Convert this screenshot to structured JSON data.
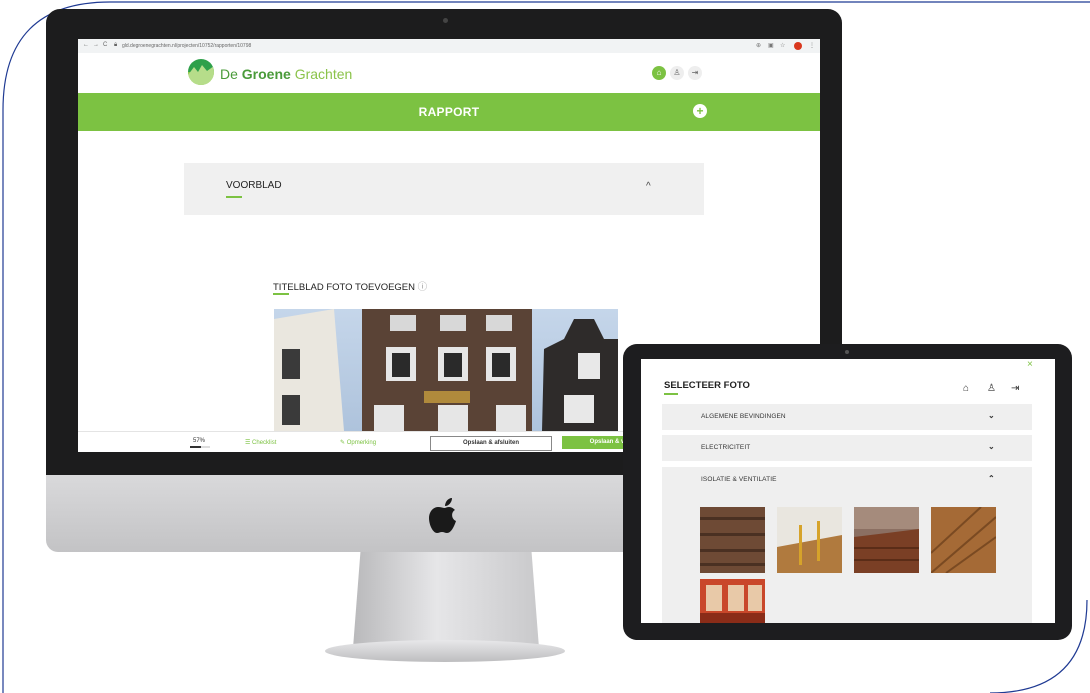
{
  "browser": {
    "url": "gld.degroenegrachten.nl/projecten/10752/rapporten/10798"
  },
  "desktop": {
    "logo": {
      "brand_bold": "Groene",
      "brand_pre": "De",
      "brand_post": "Grachten"
    },
    "header_icons": [
      "home-icon",
      "user-icon",
      "logout-icon"
    ],
    "page_title": "RAPPORT",
    "plus_symbol": "+",
    "section": {
      "title": "VOORBLAD",
      "caret": "^"
    },
    "photo_heading": "TITELBLAD FOTO TOEVOEGEN",
    "photo_heading_info": "ⓘ",
    "footer": {
      "progress_label": "57%",
      "progress_value": 0.57,
      "checklist": "Checklist",
      "opmerking": "Opmerking",
      "save_close": "Opslaan & afsluiten",
      "save_next": "Opslaan & v"
    }
  },
  "tablet": {
    "close_symbol": "×",
    "title": "SELECTEER FOTO",
    "rows": [
      {
        "label": "ALGEMENE BEVINDINGEN",
        "caret": "⌄"
      },
      {
        "label": "ELECTRICITEIT",
        "caret": "⌄"
      },
      {
        "label": "ISOLATIE & VENTILATIE",
        "caret": "⌃"
      }
    ],
    "photos": [
      "wood-floor-photo",
      "attic-photo",
      "brick-floor-photo",
      "parquet-photo",
      "orange-interior-photo"
    ]
  },
  "colors": {
    "brand_green": "#7cc242",
    "dark_green": "#2ea04a",
    "bezel": "#1c1c1d",
    "frame_line": "#1f3a93"
  }
}
